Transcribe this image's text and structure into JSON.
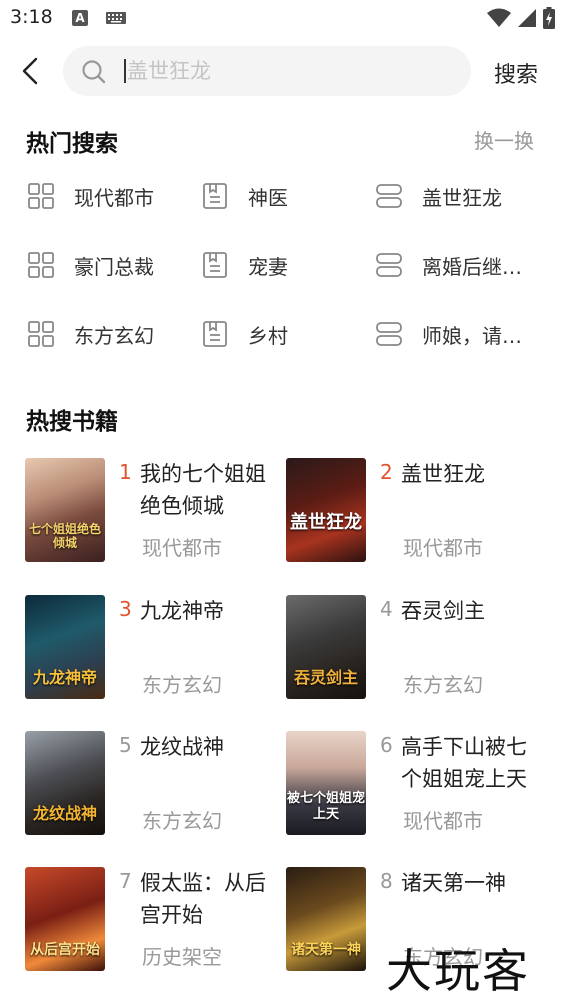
{
  "status_bar": {
    "time": "3:18",
    "notification_letter": "A"
  },
  "search": {
    "placeholder": "盖世狂龙",
    "button_label": "搜索"
  },
  "hot_search": {
    "title": "热门搜索",
    "refresh_label": "换一换",
    "items": [
      {
        "label": "现代都市",
        "icon": "grid-icon"
      },
      {
        "label": "神医",
        "icon": "book-icon"
      },
      {
        "label": "盖世狂龙",
        "icon": "stack-icon"
      },
      {
        "label": "豪门总裁",
        "icon": "grid-icon"
      },
      {
        "label": "宠妻",
        "icon": "book-icon"
      },
      {
        "label": "离婚后继…",
        "icon": "stack-icon"
      },
      {
        "label": "东方玄幻",
        "icon": "grid-icon"
      },
      {
        "label": "乡村",
        "icon": "book-icon"
      },
      {
        "label": "师娘，请…",
        "icon": "stack-icon"
      }
    ]
  },
  "hot_books": {
    "title": "热搜书籍",
    "books": [
      {
        "rank": "1",
        "title": "我的七个姐姐绝色倾城",
        "category": "现代都市",
        "cover_text": "七个姐姐绝色倾城"
      },
      {
        "rank": "2",
        "title": "盖世狂龙",
        "category": "现代都市",
        "cover_text": "盖世狂龙"
      },
      {
        "rank": "3",
        "title": "九龙神帝",
        "category": "东方玄幻",
        "cover_text": "九龙神帝"
      },
      {
        "rank": "4",
        "title": "吞灵剑主",
        "category": "东方玄幻",
        "cover_text": "吞灵剑主"
      },
      {
        "rank": "5",
        "title": "龙纹战神",
        "category": "东方玄幻",
        "cover_text": "龙纹战神"
      },
      {
        "rank": "6",
        "title": "高手下山被七个姐姐宠上天",
        "category": "现代都市",
        "cover_text": "被七个姐姐宠上天"
      },
      {
        "rank": "7",
        "title": "假太监：从后宫开始",
        "category": "历史架空",
        "cover_text": "从后宫开始"
      },
      {
        "rank": "8",
        "title": "诸天第一神",
        "category": "东方玄幻",
        "cover_text": "诸天第一神"
      }
    ]
  },
  "colors": {
    "rank_top": "#e2532d",
    "rank_other": "#999999",
    "muted": "#999999"
  },
  "watermark": "大玩客"
}
